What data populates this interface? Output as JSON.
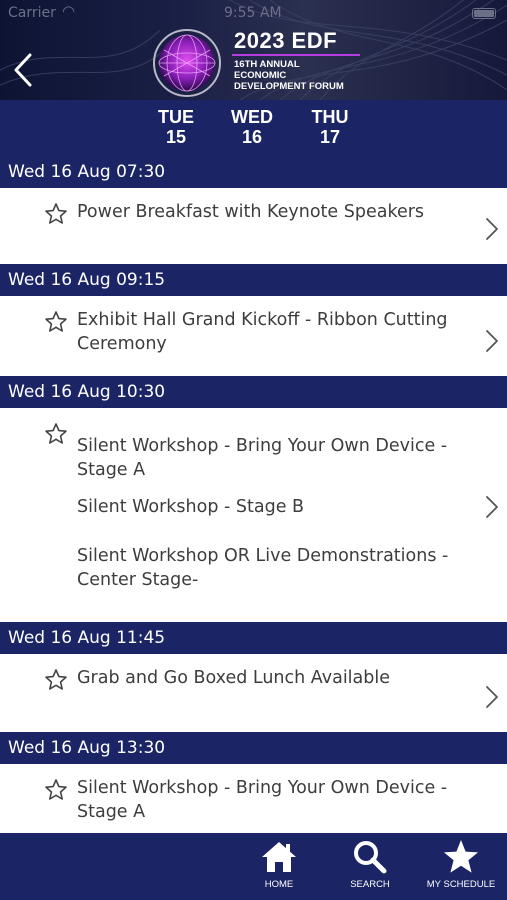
{
  "status_bar": {
    "carrier": "Carrier",
    "time": "9:55 AM"
  },
  "header": {
    "logo_title": "2023 EDF",
    "logo_lines": [
      "16TH ANNUAL",
      "ECONOMIC",
      "DEVELOPMENT FORUM"
    ]
  },
  "days": [
    {
      "name": "TUE",
      "num": "15"
    },
    {
      "name": "WED",
      "num": "16"
    },
    {
      "name": "THU",
      "num": "17"
    }
  ],
  "schedule": [
    {
      "time": "Wed 16 Aug 07:30",
      "sessions": [
        "Power Breakfast with Keynote Speakers"
      ]
    },
    {
      "time": "Wed 16 Aug 09:15",
      "sessions": [
        "Exhibit Hall Grand Kickoff - Ribbon Cutting Ceremony"
      ]
    },
    {
      "time": "Wed 16 Aug 10:30",
      "sessions": [
        "Silent Workshop - Bring Your Own Device - Stage A",
        "Silent Workshop - Stage B",
        "Silent Workshop OR Live Demonstrations - Center Stage-"
      ]
    },
    {
      "time": "Wed 16 Aug 11:45",
      "sessions": [
        "Grab and Go Boxed Lunch Available"
      ]
    },
    {
      "time": "Wed 16 Aug 13:30",
      "sessions": [
        "Silent Workshop - Bring Your Own Device - Stage A"
      ]
    }
  ],
  "tabbar": {
    "home": "HOME",
    "search": "SEARCH",
    "my_schedule": "MY SCHEDULE"
  },
  "colors": {
    "navy": "#1b2565",
    "accent_purple": "#b43ee0",
    "header_dark": "#0d1433"
  },
  "icons": {
    "back": "chevron-left-icon",
    "favorite": "star-outline-icon",
    "detail": "chevron-right-icon",
    "home": "home-icon",
    "search": "search-icon",
    "schedule": "star-filled-icon"
  }
}
